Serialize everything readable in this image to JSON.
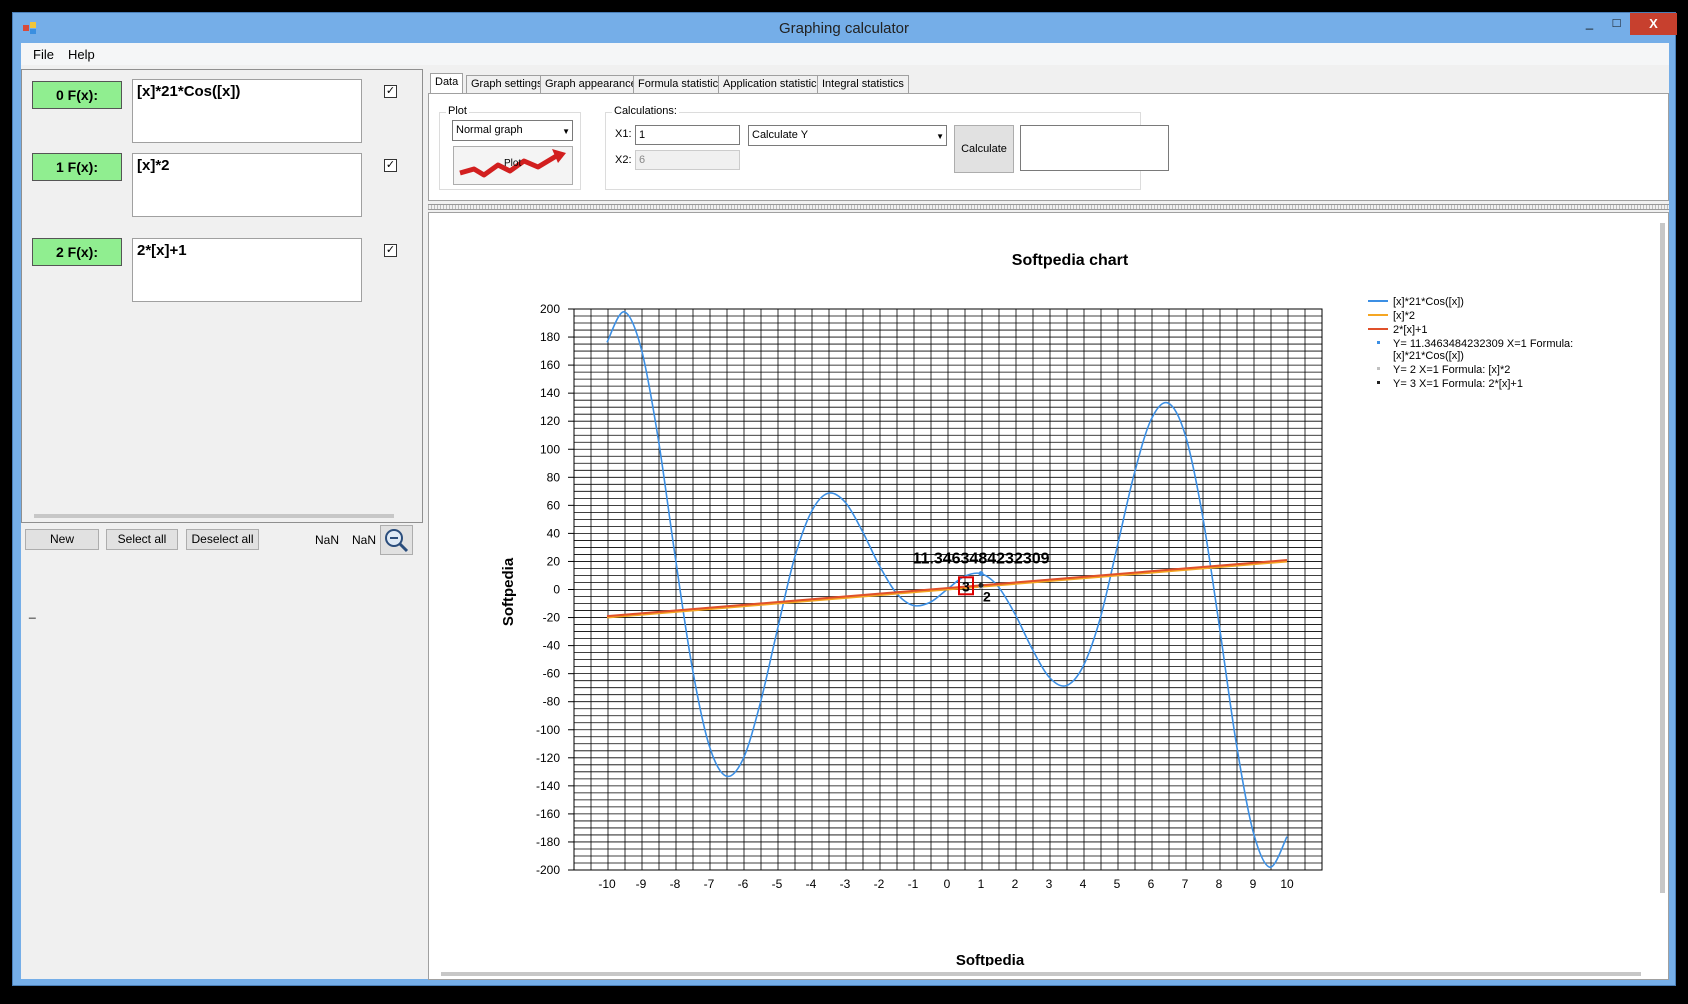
{
  "window": {
    "title": "Graphing calculator",
    "controls": [
      "_",
      "□",
      "X"
    ]
  },
  "menu": {
    "file": "File",
    "help": "Help"
  },
  "functions": [
    {
      "label": "0 F(x):",
      "formula": "[x]*21*Cos([x])",
      "checked": true
    },
    {
      "label": "1 F(x):",
      "formula": "[x]*2",
      "checked": true
    },
    {
      "label": "2 F(x):",
      "formula": "2*[x]+1",
      "checked": true
    }
  ],
  "left_buttons": {
    "new": "New",
    "select_all": "Select all",
    "deselect_all": "Deselect all"
  },
  "status": {
    "nan1": "NaN",
    "nan2": "NaN",
    "dash": "_"
  },
  "tabs": [
    "Data",
    "Graph settings",
    "Graph appearance",
    "Formula statistics",
    "Application statistics",
    "Integral statistics"
  ],
  "plot_group": {
    "title": "Plot",
    "mode": "Normal graph",
    "plot_button": "Plot"
  },
  "calc_group": {
    "title": "Calculations:",
    "x1_label": "X1:",
    "x1_value": "1",
    "x2_label": "X2:",
    "x2_value": "6",
    "mode": "Calculate Y",
    "calculate_button": "Calculate",
    "result": ""
  },
  "colors": {
    "f0": "#3c8fe4",
    "f1": "#f5a623",
    "f2": "#e0502a",
    "label_green": "#90ee90",
    "highlight": "#dd0000"
  },
  "chart_data": {
    "type": "line",
    "title": "Softpedia chart",
    "xlabel": "Softpedia",
    "ylabel": "Softpedia",
    "xlim": [
      -10,
      10
    ],
    "ylim": [
      -200,
      200
    ],
    "x_ticks": [
      "-10",
      "-9",
      "-8",
      "-7",
      "-6",
      "-5",
      "-4",
      "-3",
      "-2",
      "-1",
      "0",
      "1",
      "2",
      "3",
      "4",
      "5",
      "6",
      "7",
      "8",
      "9",
      "10"
    ],
    "y_ticks": [
      "200",
      "180",
      "160",
      "140",
      "120",
      "100",
      "80",
      "60",
      "40",
      "20",
      "0",
      "-20",
      "-40",
      "-60",
      "-80",
      "-100",
      "-120",
      "-140",
      "-160",
      "-180",
      "-200"
    ],
    "series": [
      {
        "name": "[x]*21*Cos([x])",
        "color": "#3c8fe4",
        "x": [
          -10,
          -9.5,
          -9,
          -8.5,
          -8,
          -7.5,
          -7,
          -6.5,
          -6,
          -5.5,
          -5,
          -4.5,
          -4,
          -3.5,
          -3,
          -2.5,
          -2,
          -1.5,
          -1,
          -0.5,
          0,
          0.5,
          1,
          1.5,
          2,
          2.5,
          3,
          3.5,
          4,
          4.5,
          5,
          5.5,
          6,
          6.5,
          7,
          7.5,
          8,
          8.5,
          9,
          9.5,
          10
        ],
        "y": [
          176.2,
          198.0,
          172.3,
          108.5,
          24.4,
          -54.8,
          -110.8,
          -133.0,
          -121.0,
          -81.8,
          -29.8,
          21.1,
          54.9,
          68.6,
          62.4,
          42.1,
          17.5,
          -2.2,
          -11.3,
          -9.2,
          0,
          9.2,
          11.3,
          2.2,
          -17.5,
          -42.1,
          -62.4,
          -68.6,
          -54.9,
          -21.1,
          29.8,
          81.8,
          121.0,
          133.0,
          110.8,
          54.8,
          -24.4,
          -108.5,
          -172.3,
          -198.0,
          -176.2
        ]
      },
      {
        "name": "[x]*2",
        "color": "#f5a623",
        "x": [
          -10,
          10
        ],
        "y": [
          -20,
          20
        ]
      },
      {
        "name": "2*[x]+1",
        "color": "#e0502a",
        "x": [
          -10,
          10
        ],
        "y": [
          -19,
          21
        ]
      }
    ],
    "points": [
      {
        "name": "Y= 11.3463484232309 X=1 Formula: [x]*21*Cos([x])",
        "x": 1,
        "y": 11.3463484232309,
        "label": "11.3463484232309",
        "color": "#3c8fe4"
      },
      {
        "name": "Y= 2 X=1 Formula: [x]*2",
        "x": 1,
        "y": 2,
        "label": "2",
        "color": "#c0c0c0"
      },
      {
        "name": "Y= 3 X=1 Formula: 2*[x]+1",
        "x": 1,
        "y": 3,
        "label": "3",
        "color": "#222222"
      }
    ],
    "grid": true,
    "legend": "right"
  }
}
